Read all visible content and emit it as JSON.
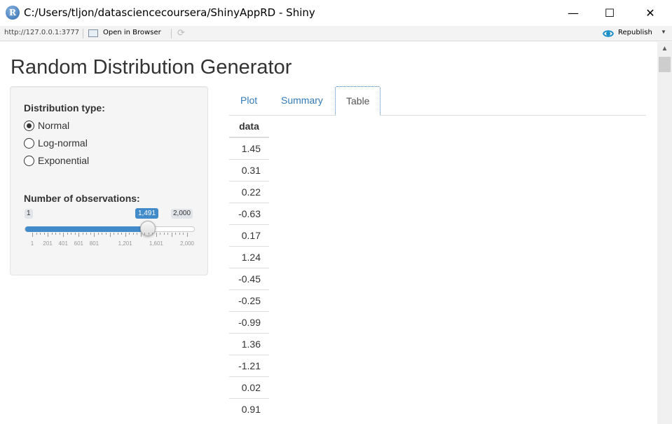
{
  "window": {
    "title": "C:/Users/tljon/datasciencecoursera/ShinyAppRD - Shiny",
    "app_icon": "r-logo-icon",
    "controls": {
      "minimize": "—",
      "maximize": "☐",
      "close": "✕"
    }
  },
  "toolbar": {
    "url": "http://127.0.0.1:3777",
    "open_in_browser": "Open in Browser",
    "republish": "Republish"
  },
  "page": {
    "title": "Random Distribution Generator"
  },
  "sidebar": {
    "distribution_label": "Distribution type:",
    "options": [
      {
        "label": "Normal",
        "checked": true
      },
      {
        "label": "Log-normal",
        "checked": false
      },
      {
        "label": "Exponential",
        "checked": false
      }
    ],
    "observations_label": "Number of observations:",
    "slider": {
      "min_label": "1",
      "max_label": "2,000",
      "value_label": "1,491",
      "min": 1,
      "max": 2000,
      "value": 1491,
      "tick_labels": [
        "1",
        "201",
        "401",
        "601",
        "801",
        "1,201",
        "1,601",
        "2,000"
      ]
    }
  },
  "tabs": [
    {
      "label": "Plot",
      "active": false
    },
    {
      "label": "Summary",
      "active": false
    },
    {
      "label": "Table",
      "active": true
    }
  ],
  "table": {
    "header": "data",
    "rows": [
      "1.45",
      "0.31",
      "0.22",
      "-0.63",
      "0.17",
      "1.24",
      "-0.45",
      "-0.25",
      "-0.99",
      "1.36",
      "-1.21",
      "0.02",
      "0.91"
    ]
  },
  "colors": {
    "accent": "#428bca",
    "link": "#337ab7"
  }
}
